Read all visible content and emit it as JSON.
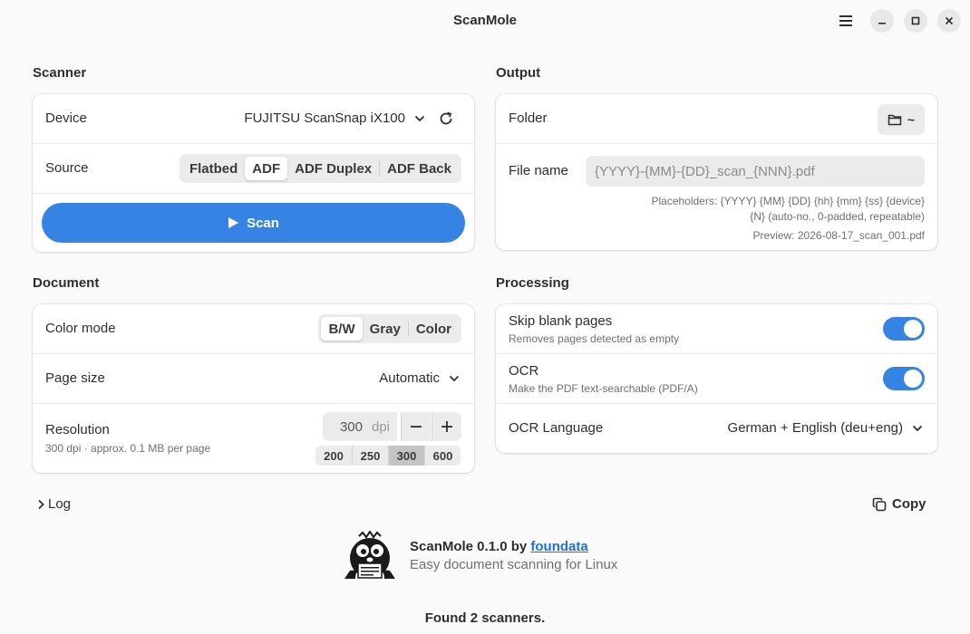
{
  "app": {
    "title": "ScanMole"
  },
  "scanner": {
    "section_title": "Scanner",
    "device_label": "Device",
    "device_value": "FUJITSU ScanSnap iX100",
    "source_label": "Source",
    "source_options": [
      "Flatbed",
      "ADF",
      "ADF Duplex",
      "ADF Back"
    ],
    "source_selected": "ADF",
    "scan_label": "Scan"
  },
  "output": {
    "section_title": "Output",
    "folder_label": "Folder",
    "folder_value": "~",
    "filename_label": "File name",
    "filename_value": "{YYYY}-{MM}-{DD}_scan_{NNN}.pdf",
    "placeholders_line1": "Placeholders: {YYYY} {MM} {DD} {hh} {mm} {ss} {device}",
    "placeholders_line2": "{N} (auto-no., 0-padded, repeatable)",
    "preview": "Preview: 2026-08-17_scan_001.pdf"
  },
  "document": {
    "section_title": "Document",
    "color_mode_label": "Color mode",
    "color_modes": [
      "B/W",
      "Gray",
      "Color"
    ],
    "color_mode_selected": "B/W",
    "page_size_label": "Page size",
    "page_size_value": "Automatic",
    "resolution_label": "Resolution",
    "resolution_sub": "300 dpi · approx. 0.1 MB per page",
    "resolution_value": "300",
    "resolution_unit": "dpi",
    "resolution_presets": [
      "200",
      "250",
      "300",
      "600"
    ],
    "resolution_preset_selected": "300"
  },
  "processing": {
    "section_title": "Processing",
    "skip_blank_label": "Skip blank pages",
    "skip_blank_sub": "Removes pages detected as empty",
    "skip_blank_on": true,
    "ocr_label": "OCR",
    "ocr_sub": "Make the PDF text-searchable (PDF/A)",
    "ocr_on": true,
    "ocr_language_label": "OCR Language",
    "ocr_language_value": "German + English (deu+eng)"
  },
  "log": {
    "label": "Log",
    "copy_label": "Copy"
  },
  "about": {
    "name_prefix": "ScanMole 0.1.0 by ",
    "author": "foundata",
    "tagline": "Easy document scanning for Linux"
  },
  "status": {
    "text": "Found 2 scanners."
  },
  "colors": {
    "accent": "#3584e4",
    "link": "#1c71d8",
    "background": "#fafafa",
    "card": "#ffffff"
  }
}
